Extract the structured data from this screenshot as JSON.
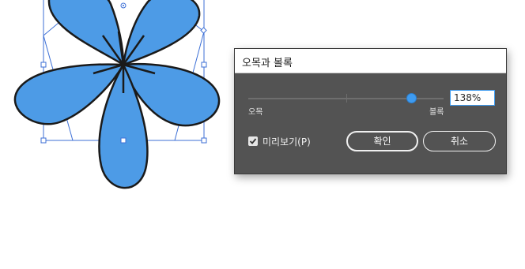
{
  "dialog": {
    "title": "오목과 볼록",
    "slider": {
      "left_label": "오목",
      "right_label": "볼록",
      "value": "138%",
      "position_fraction": 0.835
    },
    "preview": {
      "label": "미리보기(P)",
      "checked": true
    },
    "ok_label": "확인",
    "cancel_label": "취소"
  },
  "artwork": {
    "fill_color": "#4d9be6",
    "stroke_color": "#1a1a1a",
    "selection_color": "#3c6fd6"
  }
}
